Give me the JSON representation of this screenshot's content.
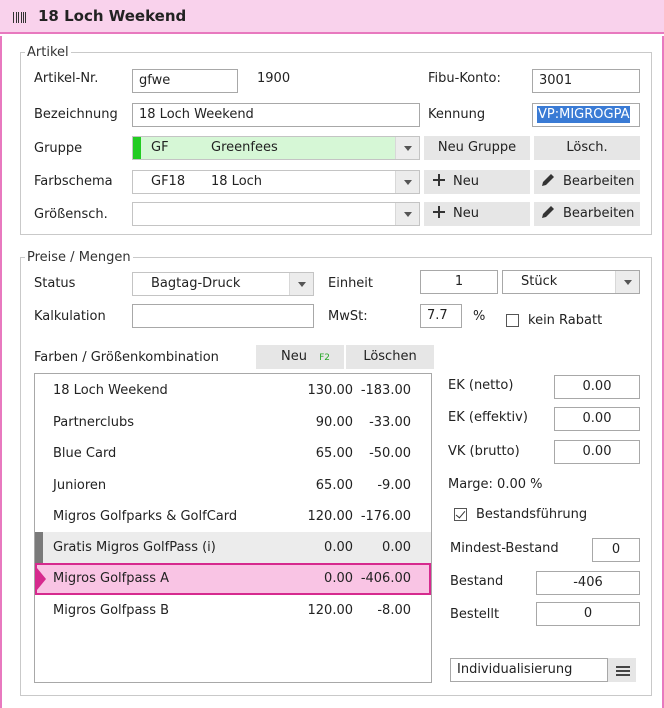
{
  "window": {
    "title": "18 Loch Weekend"
  },
  "artikel": {
    "legend": "Artikel",
    "artikel_nr_label": "Artikel-Nr.",
    "artikel_nr_value": "gfwe",
    "artikel_nr_number": "1900",
    "fibu_label": "Fibu-Konto:",
    "fibu_value": "3001",
    "bezeichnung_label": "Bezeichnung",
    "bezeichnung_value": "18 Loch Weekend",
    "kennung_label": "Kennung",
    "kennung_value": "VP:MIGROGPA",
    "gruppe_label": "Gruppe",
    "gruppe_code": "GF",
    "gruppe_name": "Greenfees",
    "gruppe_color": "#22cc22",
    "neu_gruppe_label": "Neu Gruppe",
    "loesch_label": "Lösch.",
    "farbschema_label": "Farbschema",
    "farbschema_code": "GF18",
    "farbschema_name": "18 Loch",
    "neu_label": "Neu",
    "bearbeiten_label": "Bearbeiten",
    "groessen_label": "Größensch.",
    "groessen_value": "",
    "neu2_label": "Neu",
    "bearbeiten2_label": "Bearbeiten"
  },
  "preise": {
    "legend": "Preise / Mengen",
    "status_label": "Status",
    "status_value": "Bagtag-Druck",
    "einheit_label": "Einheit",
    "einheit_qty": "1",
    "einheit_unit": "Stück",
    "kalkulation_label": "Kalkulation",
    "kalkulation_value": "",
    "mwst_label": "MwSt:",
    "mwst_value": "7.7",
    "mwst_unit": "%",
    "kein_rabatt_label": "kein Rabatt",
    "kombination_label": "Farben / Größenkombination",
    "neu_btn_label": "Neu",
    "neu_btn_shortcut": "F2",
    "loeschen_btn_label": "Löschen",
    "rows": [
      {
        "name": "18 Loch Weekend",
        "price": "130.00",
        "stock": "-183.00"
      },
      {
        "name": "Partnerclubs",
        "price": "90.00",
        "stock": "-33.00"
      },
      {
        "name": "Blue Card",
        "price": "65.00",
        "stock": "-50.00"
      },
      {
        "name": "Junioren",
        "price": "65.00",
        "stock": "-9.00"
      },
      {
        "name": "Migros Golfparks & GolfCard",
        "price": "120.00",
        "stock": "-176.00"
      },
      {
        "name": "Gratis Migros GolfPass (i)",
        "price": "0.00",
        "stock": "0.00"
      },
      {
        "name": "Migros Golfpass A",
        "price": "0.00",
        "stock": "-406.00"
      },
      {
        "name": "Migros Golfpass B",
        "price": "120.00",
        "stock": "-8.00"
      }
    ],
    "ek_netto_label": "EK (netto)",
    "ek_netto_value": "0.00",
    "ek_effektiv_label": "EK (effektiv)",
    "ek_effektiv_value": "0.00",
    "vk_brutto_label": "VK (brutto)",
    "vk_brutto_value": "0.00",
    "marge_label": "Marge: 0.00 %",
    "bestandsfuehrung_label": "Bestandsführung",
    "mindest_label": "Mindest-Bestand",
    "mindest_value": "0",
    "bestand_label": "Bestand",
    "bestand_value": "-406",
    "bestellt_label": "Bestellt",
    "bestellt_value": "0",
    "individualisierung_label": "Individualisierung"
  },
  "colors": {
    "accent": "#e879bf",
    "title_bg": "#f9d2ec",
    "selected_row": "#f9c4e4",
    "selected_border": "#d62a8e"
  }
}
